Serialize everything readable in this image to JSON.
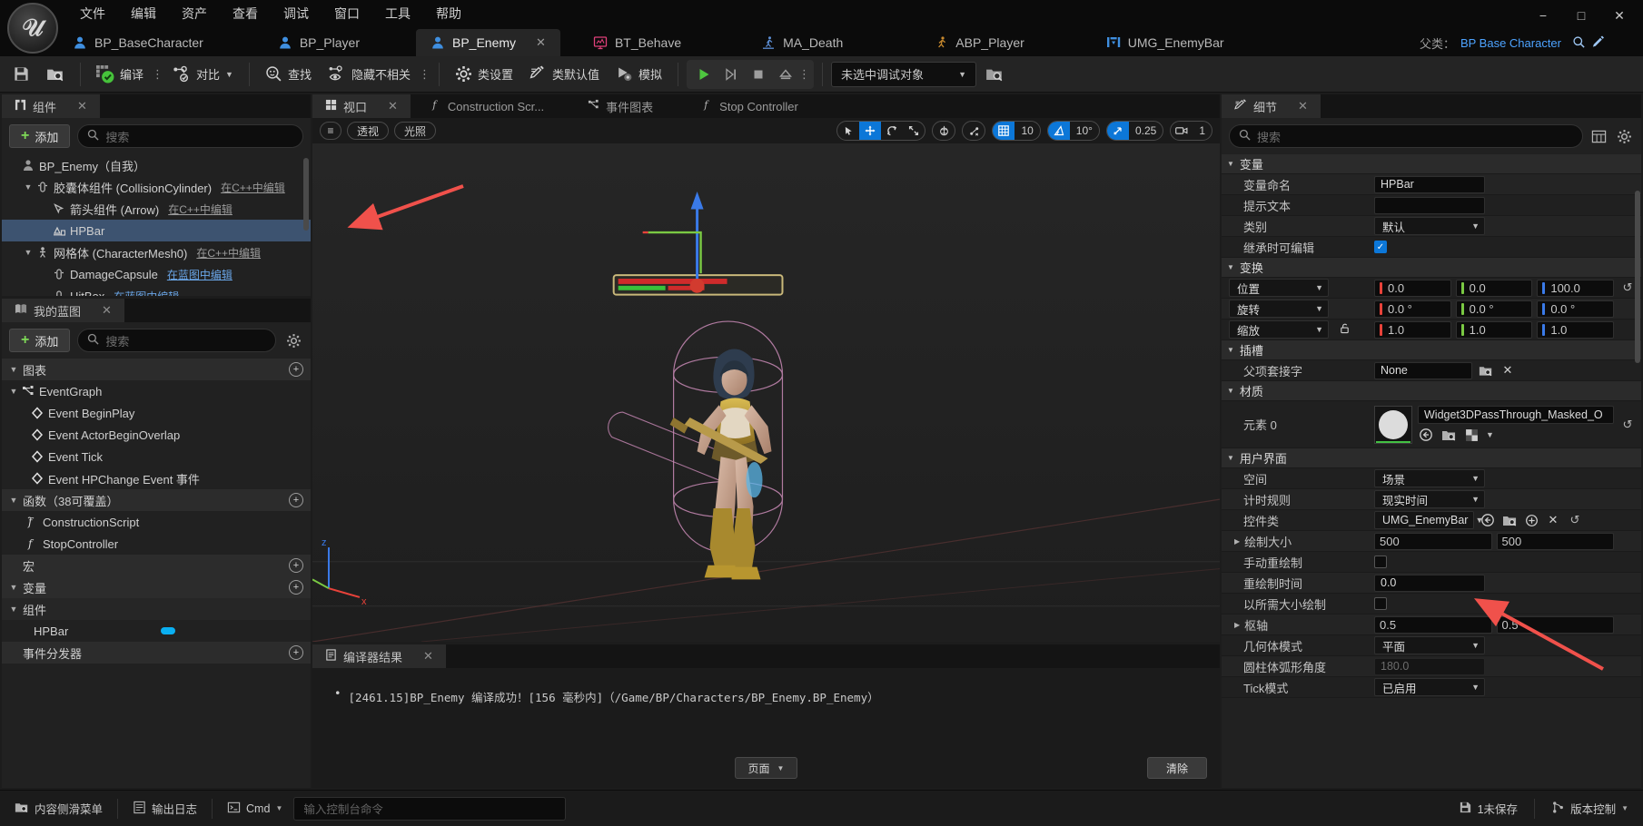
{
  "window": {
    "menu": [
      "文件",
      "编辑",
      "资产",
      "查看",
      "调试",
      "窗口",
      "工具",
      "帮助"
    ],
    "minimize": "−",
    "maximize": "□",
    "close": "✕"
  },
  "doc_tabs": [
    {
      "label": "BP_BaseCharacter",
      "icon": "blueprint-character-icon",
      "active": false
    },
    {
      "label": "BP_Player",
      "icon": "blueprint-character-icon",
      "active": false
    },
    {
      "label": "BP_Enemy",
      "icon": "blueprint-character-icon",
      "active": true,
      "close": "✕"
    },
    {
      "label": "BT_Behave",
      "icon": "behavior-tree-icon",
      "active": false
    },
    {
      "label": "MA_Death",
      "icon": "montage-icon",
      "active": false
    },
    {
      "label": "ABP_Player",
      "icon": "anim-blueprint-icon",
      "active": false
    },
    {
      "label": "UMG_EnemyBar",
      "icon": "widget-blueprint-icon",
      "active": false
    }
  ],
  "parent_class": {
    "label": "父类：",
    "value": "BP Base Character"
  },
  "toolbar": {
    "save": "保存",
    "browse": "浏览",
    "compile": "编译",
    "diff": "对比",
    "find": "查找",
    "hide_unrelated": "隐藏不相关",
    "class_settings": "类设置",
    "class_defaults": "类默认值",
    "simulate": "模拟",
    "play": "运行",
    "step": "单步",
    "stop": "停止",
    "eject": "弹出",
    "debug_object": "未选中调试对象"
  },
  "components_panel": {
    "tab": "组件",
    "close": "✕",
    "add": "添加",
    "search_placeholder": "搜索",
    "items": [
      {
        "label": "BP_Enemy（自我）",
        "indent": 0,
        "icon": "actor-icon",
        "caret": "",
        "suffix": "",
        "selected": false
      },
      {
        "label": "胶囊体组件 (CollisionCylinder)",
        "indent": 1,
        "icon": "capsule-icon",
        "caret": "▼",
        "suffix": "在C++中编辑",
        "selected": false
      },
      {
        "label": "箭头组件 (Arrow)",
        "indent": 2,
        "icon": "arrow-comp-icon",
        "caret": "",
        "suffix": "在C++中编辑",
        "selected": false
      },
      {
        "label": "HPBar",
        "indent": 2,
        "icon": "widget-comp-icon",
        "caret": "",
        "suffix": "",
        "selected": true
      },
      {
        "label": "网格体 (CharacterMesh0)",
        "indent": 1,
        "icon": "mesh-icon",
        "caret": "▼",
        "suffix": "在C++中编辑",
        "selected": false
      },
      {
        "label": "DamageCapsule",
        "indent": 2,
        "icon": "capsule-icon",
        "caret": "",
        "suffix": "在蓝图中编辑",
        "suffix_blue": true,
        "selected": false
      },
      {
        "label": "HitBox",
        "indent": 2,
        "icon": "capsule-icon",
        "caret": "",
        "suffix": "在蓝图中编辑",
        "suffix_blue": true,
        "selected": false
      }
    ]
  },
  "myblueprint_panel": {
    "tab": "我的蓝图",
    "close": "✕",
    "add": "添加",
    "search_placeholder": "搜索",
    "sections": [
      {
        "header": "图表",
        "caret": "▼",
        "plus": "+",
        "items": [
          {
            "label": "EventGraph",
            "icon": "graph-icon",
            "indent": 0,
            "caret": "▼"
          },
          {
            "label": "Event BeginPlay",
            "icon": "event-node-icon",
            "indent": 1,
            "caret": ""
          },
          {
            "label": "Event ActorBeginOverlap",
            "icon": "event-node-icon",
            "indent": 1,
            "caret": ""
          },
          {
            "label": "Event Tick",
            "icon": "event-node-icon",
            "indent": 1,
            "caret": ""
          },
          {
            "label": "Event HPChange Event 事件",
            "icon": "event-node-icon",
            "indent": 1,
            "caret": ""
          }
        ]
      },
      {
        "header": "函数（38可覆盖）",
        "caret": "▼",
        "plus": "+",
        "items": [
          {
            "label": "ConstructionScript",
            "icon": "function-icon",
            "indent": 1,
            "caret": ""
          },
          {
            "label": "StopController",
            "icon": "function-icon",
            "indent": 1,
            "caret": ""
          }
        ]
      },
      {
        "header": "宏",
        "caret": "",
        "plus": "+",
        "items": []
      },
      {
        "header": "变量",
        "caret": "▼",
        "plus": "+",
        "items": []
      },
      {
        "header": "组件",
        "caret": "▼",
        "plus": "",
        "items": [
          {
            "label": "HPBar",
            "icon": "",
            "indent": 1,
            "caret": "",
            "pill": "#0aaff1"
          }
        ]
      },
      {
        "header": "事件分发器",
        "caret": "",
        "plus": "+",
        "items": []
      }
    ]
  },
  "viewport_tabs": [
    {
      "label": "视口",
      "icon": "viewport-icon",
      "active": true,
      "close": "✕"
    },
    {
      "label": "Construction Scr...",
      "icon": "function-icon",
      "active": false
    },
    {
      "label": "事件图表",
      "icon": "graph-icon",
      "active": false
    },
    {
      "label": "Stop Controller",
      "icon": "function-icon",
      "active": false
    }
  ],
  "viewport_toolbar": {
    "menu": "≡",
    "perspective": "透视",
    "lit": "光照",
    "grid_snap_value": "10",
    "angle_snap_value": "10°",
    "scale_snap_value": "0.25",
    "camera_speed": "1"
  },
  "compiler_panel": {
    "tab": "编译器结果",
    "close": "✕",
    "messages": [
      "[2461.15]BP_Enemy 编译成功！[156 毫秒内]（/Game/BP/Characters/BP_Enemy.BP_Enemy）"
    ],
    "page_button": "页面",
    "clear_button": "清除"
  },
  "details_panel": {
    "tab": "细节",
    "close": "✕",
    "search_placeholder": "搜索",
    "sections": [
      {
        "title": "变量",
        "rows": [
          {
            "label": "变量命名",
            "type": "text",
            "value": "HPBar"
          },
          {
            "label": "提示文本",
            "type": "text",
            "value": ""
          },
          {
            "label": "类别",
            "type": "dropdown",
            "value": "默认"
          },
          {
            "label": "继承时可编辑",
            "type": "checkbox",
            "checked": true
          }
        ]
      },
      {
        "title": "变换",
        "rows": [
          {
            "label": "位置",
            "type": "vector3",
            "dropdown": "位置",
            "values": [
              "0.0",
              "0.0",
              "100.0"
            ],
            "reset": true
          },
          {
            "label": "旋转",
            "type": "vector3",
            "dropdown": "旋转",
            "values": [
              "0.0 °",
              "0.0 °",
              "0.0 °"
            ]
          },
          {
            "label": "缩放",
            "type": "vector3",
            "dropdown": "缩放",
            "values": [
              "1.0",
              "1.0",
              "1.0"
            ],
            "lock": true
          }
        ]
      },
      {
        "title": "插槽",
        "rows": [
          {
            "label": "父项套接字",
            "type": "asset_none",
            "value": "None"
          }
        ]
      },
      {
        "title": "材质",
        "rows": [
          {
            "label": "元素 0",
            "type": "material",
            "value": "Widget3DPassThrough_Masked_O",
            "reset": true
          }
        ]
      },
      {
        "title": "用户界面",
        "rows": [
          {
            "label": "空间",
            "type": "dropdown",
            "value": "场景"
          },
          {
            "label": "计时规则",
            "type": "dropdown",
            "value": "现实时间"
          },
          {
            "label": "控件类",
            "type": "asset_class",
            "value": "UMG_EnemyBar",
            "reset": true
          },
          {
            "label": "绘制大小",
            "type": "vector2",
            "values": [
              "500",
              "500"
            ],
            "arrow": true
          },
          {
            "label": "手动重绘制",
            "type": "checkbox",
            "checked": false
          },
          {
            "label": "重绘制时间",
            "type": "text",
            "value": "0.0"
          },
          {
            "label": "以所需大小绘制",
            "type": "checkbox",
            "checked": false
          },
          {
            "label": "枢轴",
            "type": "vector2",
            "values": [
              "0.5",
              "0.5"
            ],
            "arrow": true
          },
          {
            "label": "几何体模式",
            "type": "dropdown",
            "value": "平面"
          },
          {
            "label": "圆柱体弧形角度",
            "type": "text_dim",
            "value": "180.0"
          },
          {
            "label": "Tick模式",
            "type": "dropdown",
            "value": "已启用"
          }
        ]
      }
    ]
  },
  "statusbar": {
    "content_drawer": "内容侧滑菜单",
    "output_log": "输出日志",
    "cmd": "Cmd",
    "console_placeholder": "输入控制台命令",
    "unsaved": "1未保存",
    "source_control": "版本控制"
  },
  "colors": {
    "accent_blue": "#0c77d8",
    "select_blue": "#3d5370",
    "green": "#7ed957",
    "annotation_red": "#f0514b",
    "axis_x": "#e8423a",
    "axis_y": "#7ac943",
    "axis_z": "#3a7ae8"
  }
}
